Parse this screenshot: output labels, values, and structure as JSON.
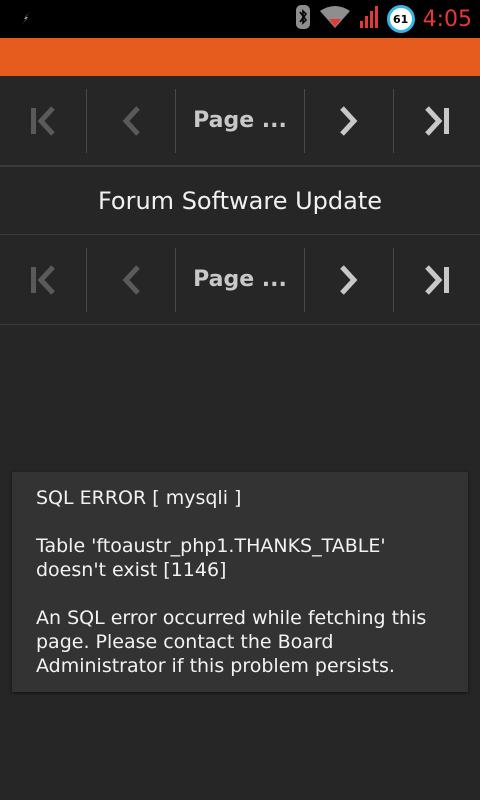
{
  "status_bar": {
    "clock": "4:05",
    "battery_level": "61",
    "icons": [
      "usb-debug-icon",
      "bluetooth-icon",
      "wifi-icon",
      "signal-icon",
      "battery-icon"
    ]
  },
  "colors": {
    "accent": "#e65c1e",
    "background": "#262626",
    "clock": "#e53935"
  },
  "pager_top": {
    "page_label": "Page ..."
  },
  "pager_bottom": {
    "page_label": "Page ..."
  },
  "thread": {
    "title": "Forum Software Update"
  },
  "error": {
    "heading": "SQL ERROR [ mysqli ]",
    "detail": "Table 'ftoaustr_php1.THANKS_TABLE' doesn't exist [1146]",
    "message": "An SQL error occurred while fetching this page. Please contact the Board Administrator if this problem persists."
  }
}
